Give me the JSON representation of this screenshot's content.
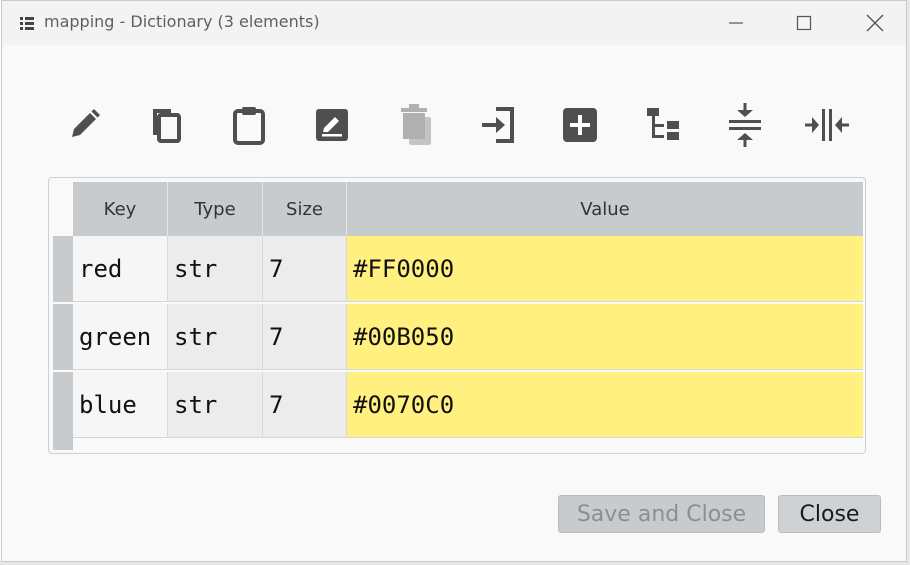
{
  "window": {
    "title": "mapping - Dictionary (3 elements)"
  },
  "toolbar": {
    "icons": [
      "edit-pencil",
      "copy",
      "paste-clipboard",
      "edit-box",
      "delete-disabled",
      "import",
      "add-box",
      "tree-view",
      "collapse-rows",
      "collapse-columns"
    ]
  },
  "table": {
    "headers": {
      "key": "Key",
      "type": "Type",
      "size": "Size",
      "value": "Value"
    },
    "rows": [
      {
        "key": "red",
        "type": "str",
        "size": "7",
        "value": "#FF0000"
      },
      {
        "key": "green",
        "type": "str",
        "size": "7",
        "value": "#00B050"
      },
      {
        "key": "blue",
        "type": "str",
        "size": "7",
        "value": "#0070C0"
      }
    ]
  },
  "buttons": {
    "save_close": "Save and Close",
    "close": "Close"
  },
  "colors": {
    "value_highlight": "#fff07f",
    "header_bg": "#c8cbce",
    "icon": "#4f4f4f",
    "icon_disabled": "#b0b0b0"
  }
}
